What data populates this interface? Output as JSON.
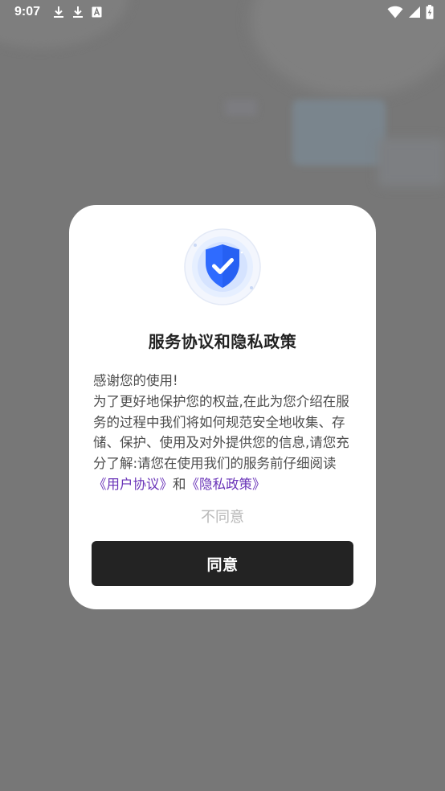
{
  "status_bar": {
    "time": "9:07",
    "left_icons": [
      "download-icon",
      "download-icon",
      "text-recognition-icon"
    ],
    "right_icons": [
      "wifi-icon",
      "cellular-signal-icon",
      "battery-charging-icon"
    ]
  },
  "dialog": {
    "icon": "shield-check-icon",
    "title": "服务协议和隐私政策",
    "body": {
      "line1": "感谢您的使用!",
      "text": "为了更好地保护您的权益,在此为您介绍在服务的过程中我们将如何规范安全地收集、存储、保护、使用及对外提供您的信息,请您充分了解:请您在使用我们的服务前仔细阅读",
      "user_agreement_link": "《用户协议》",
      "connector": "和",
      "privacy_policy_link": "《隐私政策》"
    },
    "disagree_label": "不同意",
    "agree_label": "同意"
  },
  "colors": {
    "overlay": "#777777",
    "accent_link": "#6a34b8",
    "shield_blue": "#2f6bff",
    "agree_button_bg": "#232323",
    "disagree_text": "#b8b8b8"
  }
}
